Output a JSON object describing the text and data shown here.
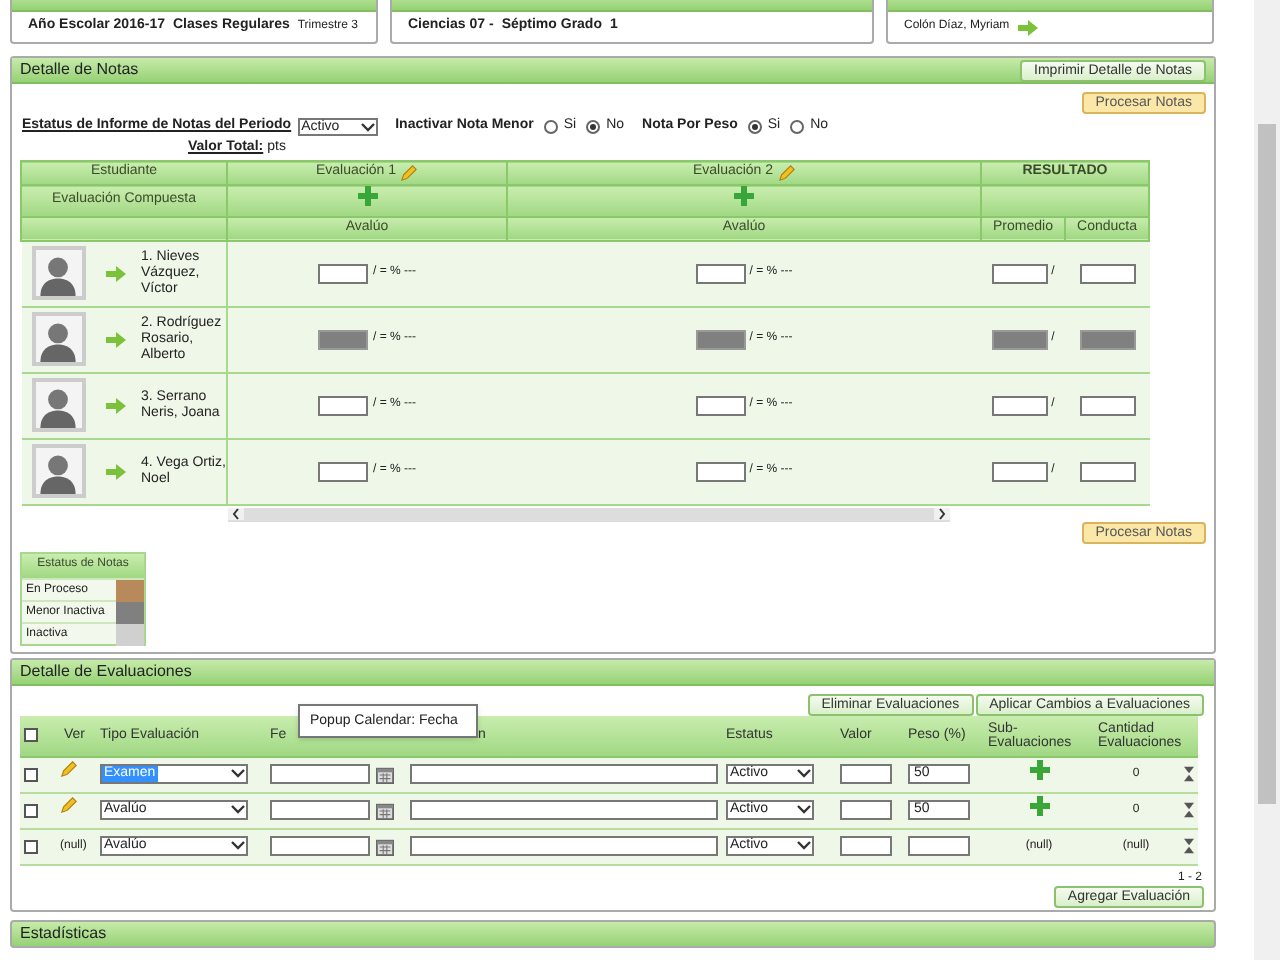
{
  "header_cards": [
    {
      "texts": [
        {
          "text": "Año Escolar 2016-17",
          "kind": "main"
        },
        {
          "text": "Clases Regulares",
          "kind": "main"
        },
        {
          "text": "Trimestre 3",
          "kind": "small"
        }
      ],
      "link_arrow": false
    },
    {
      "texts": [
        {
          "text": "Ciencias 07 -",
          "kind": "main"
        },
        {
          "text": "Séptimo Grado",
          "kind": "main"
        },
        {
          "text": "1",
          "kind": "main"
        }
      ],
      "link_arrow": false
    },
    {
      "texts": [
        {
          "text": "Colón Díaz, Myriam",
          "kind": "small"
        }
      ],
      "link_arrow": true
    }
  ],
  "notas": {
    "title": "Detalle de Notas",
    "print_button": "Imprimir Detalle de Notas",
    "process_button_top": "Procesar Notas",
    "process_button_bottom": "Procesar Notas",
    "status_label": "Estatus de Informe de Notas del Periodo",
    "status_value": "Activo",
    "toggles": [
      {
        "label": "Inactivar Nota Menor",
        "options": [
          {
            "label": "Si",
            "selected": false
          },
          {
            "label": "No",
            "selected": true
          }
        ]
      },
      {
        "label": "Nota Por Peso",
        "options": [
          {
            "label": "Si",
            "selected": true
          },
          {
            "label": "No",
            "selected": false
          }
        ]
      }
    ],
    "valor_total_label": "Valor Total:",
    "valor_total_unit": "pts",
    "grade_table": {
      "student_header": "Estudiante",
      "composite_header": "Evaluación Compuesta",
      "result_header": "RESULTADO",
      "evaluations": [
        {
          "title": "Evaluación 1",
          "sub": "Avalúo"
        },
        {
          "title": "Evaluación 2",
          "sub": "Avalúo"
        }
      ],
      "result_columns": [
        "Promedio",
        "Conducta"
      ],
      "rows": [
        {
          "name": "1. Nieves Vázquez, Víctor",
          "disabled": false,
          "grades": [
            "/ = % ---",
            "/ = % ---"
          ],
          "average_sep": "/"
        },
        {
          "name": "2. Rodríguez Rosario, Alberto",
          "disabled": true,
          "grades": [
            "/ = % ---",
            "/ = % ---"
          ],
          "average_sep": "/"
        },
        {
          "name": "3. Serrano Neris, Joana",
          "disabled": false,
          "grades": [
            "/ = % ---",
            "/ = % ---"
          ],
          "average_sep": "/"
        },
        {
          "name": "4. Vega Ortiz, Noel",
          "disabled": false,
          "grades": [
            "/ = % ---",
            "/ = % ---"
          ],
          "average_sep": "/"
        }
      ]
    },
    "legend": {
      "title": "Estatus de Notas",
      "items": [
        {
          "label": "En Proceso",
          "color": "#b8895a"
        },
        {
          "label": "Menor Inactiva",
          "color": "#808080"
        },
        {
          "label": "Inactiva",
          "color": "#d0d0d0"
        }
      ]
    }
  },
  "evaluaciones": {
    "title": "Detalle de Evaluaciones",
    "buttons": [
      "Eliminar Evaluaciones",
      "Aplicar Cambios a Evaluaciones"
    ],
    "all_checked": false,
    "columns": [
      "Ver",
      "Tipo Evaluación",
      "Fe",
      "n",
      "Estatus",
      "Valor",
      "Peso (%)",
      "Sub-Evaluaciones",
      "Cantidad Evaluaciones"
    ],
    "rows": [
      {
        "checked": false,
        "ver": {
          "kind": "edit"
        },
        "tipo": "Examen",
        "focused": true,
        "status": "Activo",
        "peso": "50",
        "sub": {
          "kind": "add"
        },
        "cantidad": "0"
      },
      {
        "checked": false,
        "ver": {
          "kind": "edit"
        },
        "tipo": "Avalúo",
        "focused": false,
        "status": "Activo",
        "peso": "50",
        "sub": {
          "kind": "add"
        },
        "cantidad": "0"
      },
      {
        "checked": false,
        "ver": {
          "kind": "text",
          "text": "(null)"
        },
        "tipo": "Avalúo",
        "focused": false,
        "status": "Activo",
        "peso": "",
        "sub": {
          "kind": "text",
          "text": "(null)"
        },
        "cantidad": "(null)"
      }
    ],
    "pagination": "1 - 2",
    "add_button": "Agregar Evaluación",
    "tooltip": "Popup Calendar: Fecha"
  },
  "estadisticas": {
    "title": "Estadísticas"
  }
}
